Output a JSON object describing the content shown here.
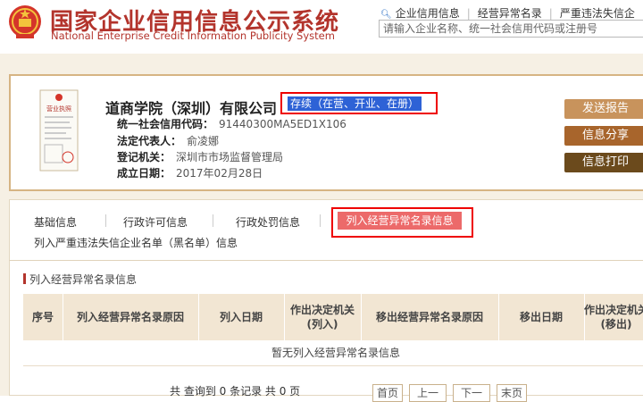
{
  "header": {
    "title_cn": "国家企业信用信息公示系统",
    "title_en": "National Enterprise Credit Information Publicity System",
    "nav": [
      "企业信用信息",
      "经营异常名录",
      "严重违法失信企"
    ],
    "search_placeholder": "请输入企业名称、统一社会信用代码或注册号"
  },
  "company": {
    "name": "道商学院（深圳）有限公司",
    "status": "存续（在营、开业、在册）",
    "license_label": "营业执照",
    "credit_code_label": "统一社会信用代码：",
    "credit_code": "91440300MA5ED1X106",
    "legal_rep_label": "法定代表人：",
    "legal_rep": "俞凌娜",
    "authority_label": "登记机关：",
    "authority": "深圳市市场监督管理局",
    "est_label": "成立日期：",
    "est_date": "2017年02月28日"
  },
  "actions": {
    "send": "发送报告",
    "share": "信息分享",
    "print": "信息打印"
  },
  "tabs": {
    "basic": "基础信息",
    "permit": "行政许可信息",
    "penalty": "行政处罚信息",
    "abnormal": "列入经营异常名录信息",
    "blacklist": "列入严重违法失信企业名单（黑名单）信息"
  },
  "section": {
    "title": "列入经营异常名录信息",
    "columns": [
      "序号",
      "列入经营异常名录原因",
      "列入日期",
      "作出决定机关(列入)",
      "移出经营异常名录原因",
      "移出日期",
      "作出决定机关(移出)"
    ],
    "empty": "暂无列入经营异常名录信息"
  },
  "pager": {
    "summary": "共 查询到 0 条记录 共 0 页",
    "first": "首页",
    "prev": "上一",
    "next": "下一",
    "last": "末页"
  },
  "colors": {
    "brand": "#b3342c",
    "status": "#2e62d6",
    "active_tab": "#ec6a6a"
  }
}
